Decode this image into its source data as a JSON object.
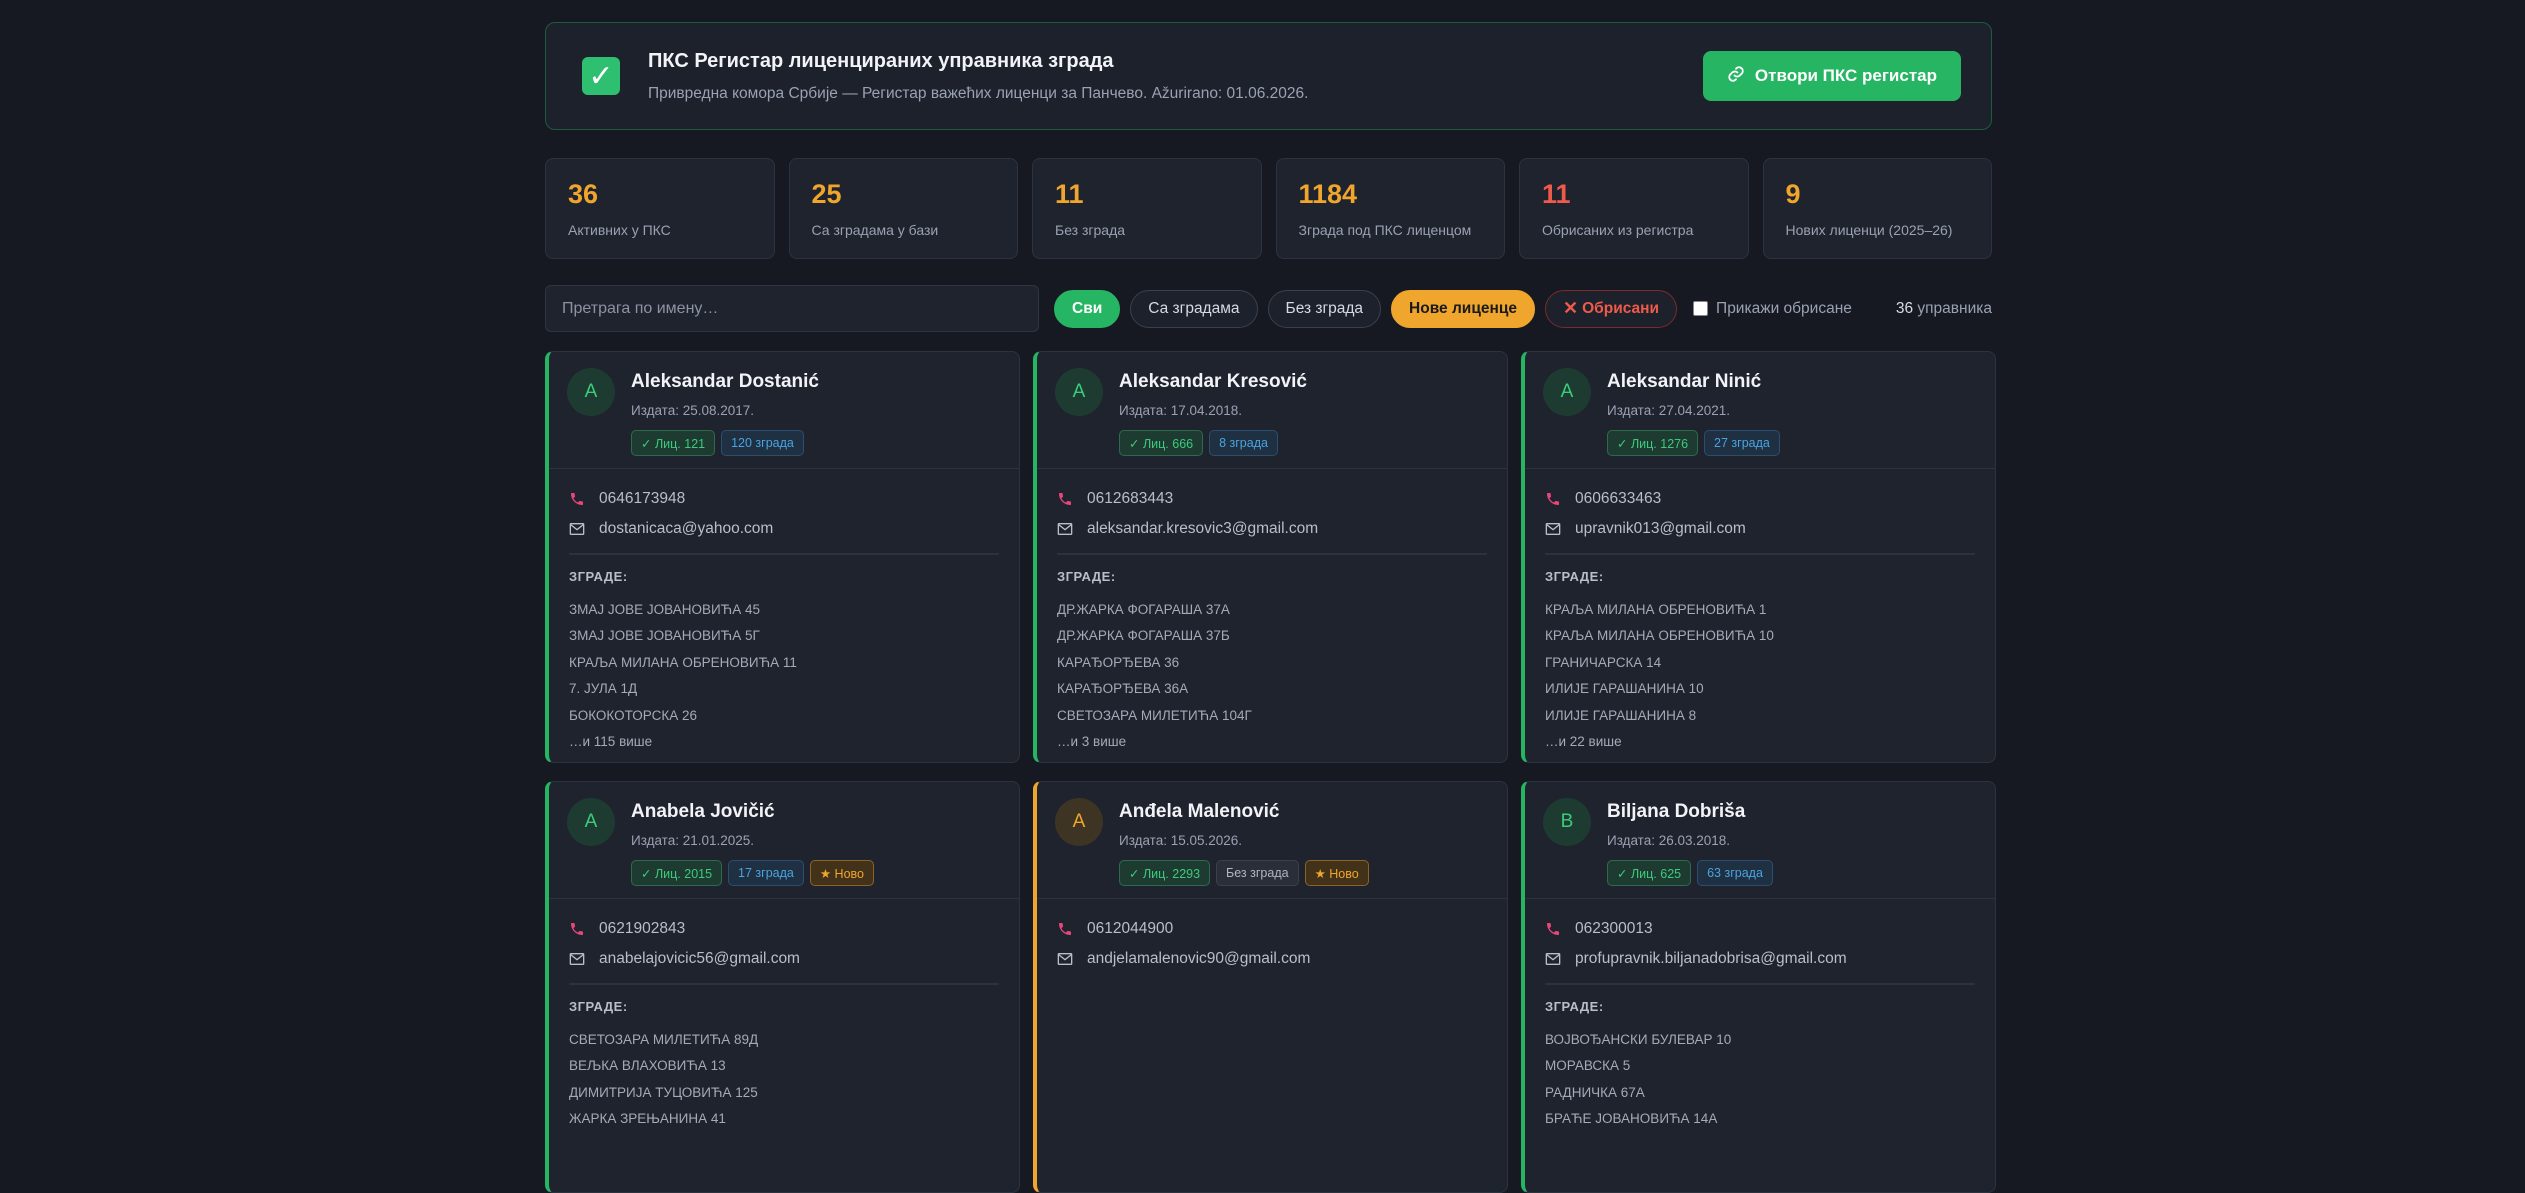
{
  "banner": {
    "title": "ПКС Регистар лиценцираних управника зграда",
    "subtitle": "Привредна комора Србије — Регистар важећих лиценци за Панчево. Ažurirano: 01.06.2026.",
    "button_label": "Отвори ПКС регистар",
    "button_icon": "link-icon"
  },
  "stats": [
    {
      "value": "36",
      "label": "Активних у ПКС",
      "color": "#f0a52d"
    },
    {
      "value": "25",
      "label": "Са зградама у бази",
      "color": "#f0a52d"
    },
    {
      "value": "11",
      "label": "Без зграда",
      "color": "#f0a52d"
    },
    {
      "value": "1184",
      "label": "Зграда под ПКС лиценцом",
      "color": "#f0a52d"
    },
    {
      "value": "11",
      "label": "Обрисаних из регистра",
      "color": "#ef5a4a"
    },
    {
      "value": "9",
      "label": "Нових лиценци (2025–26)",
      "color": "#f0a52d"
    }
  ],
  "filters": {
    "search_placeholder": "Претрага по имену…",
    "all": "Сви",
    "with_buildings": "Са зградама",
    "without_buildings": "Без зграда",
    "new_licenses": "Нове лиценце",
    "deleted": "Обрисани",
    "show_deleted": "Прикажи обрисане",
    "count_number": "36",
    "count_label": " управника"
  },
  "labels": {
    "buildings_heading": "ЗГРАДЕ:"
  },
  "cards": [
    {
      "initial": "A",
      "name": "Aleksandar Dostanić",
      "issued": "Издата: 25.08.2017.",
      "license": "✓ Лиц. 121",
      "buildings_badge": "120 зграда",
      "new_badge": "",
      "phone": "0646173948",
      "email": "dostanicaca@yahoo.com",
      "buildings": [
        "ЗМАЈ ЈОВЕ ЈОВАНОВИЋА 45",
        "ЗМАЈ ЈОВЕ ЈОВАНОВИЋА 5Г",
        "КРАЉА МИЛАНА ОБРЕНОВИЋА 11",
        "7. ЈУЛА 1Д",
        "БОКОКОТОРСКА 26"
      ],
      "more": "…и 115 више"
    },
    {
      "initial": "A",
      "name": "Aleksandar Kresović",
      "issued": "Издата: 17.04.2018.",
      "license": "✓ Лиц. 666",
      "buildings_badge": "8 зграда",
      "new_badge": "",
      "phone": "0612683443",
      "email": "aleksandar.kresovic3@gmail.com",
      "buildings": [
        "ДР.ЖАРКА ФОГАРАША 37А",
        "ДР.ЖАРКА ФОГАРАША 37Б",
        "КАРАЂОРЂЕВА 36",
        "КАРАЂОРЂЕВА 36А",
        "СВЕТОЗАРА МИЛЕТИЋА 104Г"
      ],
      "more": "…и 3 више"
    },
    {
      "initial": "A",
      "name": "Aleksandar Ninić",
      "issued": "Издата: 27.04.2021.",
      "license": "✓ Лиц. 1276",
      "buildings_badge": "27 зграда",
      "new_badge": "",
      "phone": "0606633463",
      "email": "upravnik013@gmail.com",
      "buildings": [
        "КРАЉА МИЛАНА ОБРЕНОВИЋА 1",
        "КРАЉА МИЛАНА ОБРЕНОВИЋА 10",
        "ГРАНИЧАРСКА 14",
        "ИЛИЈЕ ГАРАШАНИНА 10",
        "ИЛИЈЕ ГАРАШАНИНА 8"
      ],
      "more": "…и 22 више"
    },
    {
      "initial": "A",
      "name": "Anabela Jovičić",
      "issued": "Издата: 21.01.2025.",
      "license": "✓ Лиц. 2015",
      "buildings_badge": "17 зграда",
      "new_badge": "★ Ново",
      "phone": "0621902843",
      "email": "anabelajovicic56@gmail.com",
      "buildings": [
        "СВЕТОЗАРА МИЛЕТИЋА 89Д",
        "ВЕЉКА ВЛАХОВИЋА 13",
        "ДИМИТРИЈА ТУЦОВИЋА 125",
        "ЖАРКА ЗРЕЊАНИНА 41"
      ],
      "more": ""
    },
    {
      "initial": "A",
      "name": "Anđela Malenović",
      "issued": "Издата: 15.05.2026.",
      "license": "✓ Лиц. 2293",
      "no_buildings_badge": "Без зграда",
      "new_badge": "★ Ново",
      "phone": "0612044900",
      "email": "andjelamalenovic90@gmail.com",
      "buildings": [],
      "more": ""
    },
    {
      "initial": "B",
      "name": "Biljana Dobriša",
      "issued": "Издата: 26.03.2018.",
      "license": "✓ Лиц. 625",
      "buildings_badge": "63 зграда",
      "new_badge": "",
      "phone": "062300013",
      "email": "profupravnik.biljanadobrisa@gmail.com",
      "buildings": [
        "ВОЈВОЂАНСКИ БУЛЕВАР 10",
        "МОРАВСКА 5",
        "РАДНИЧКА 67А",
        "БРАЋЕ ЈОВАНОВИЋА 14А"
      ],
      "more": ""
    }
  ]
}
